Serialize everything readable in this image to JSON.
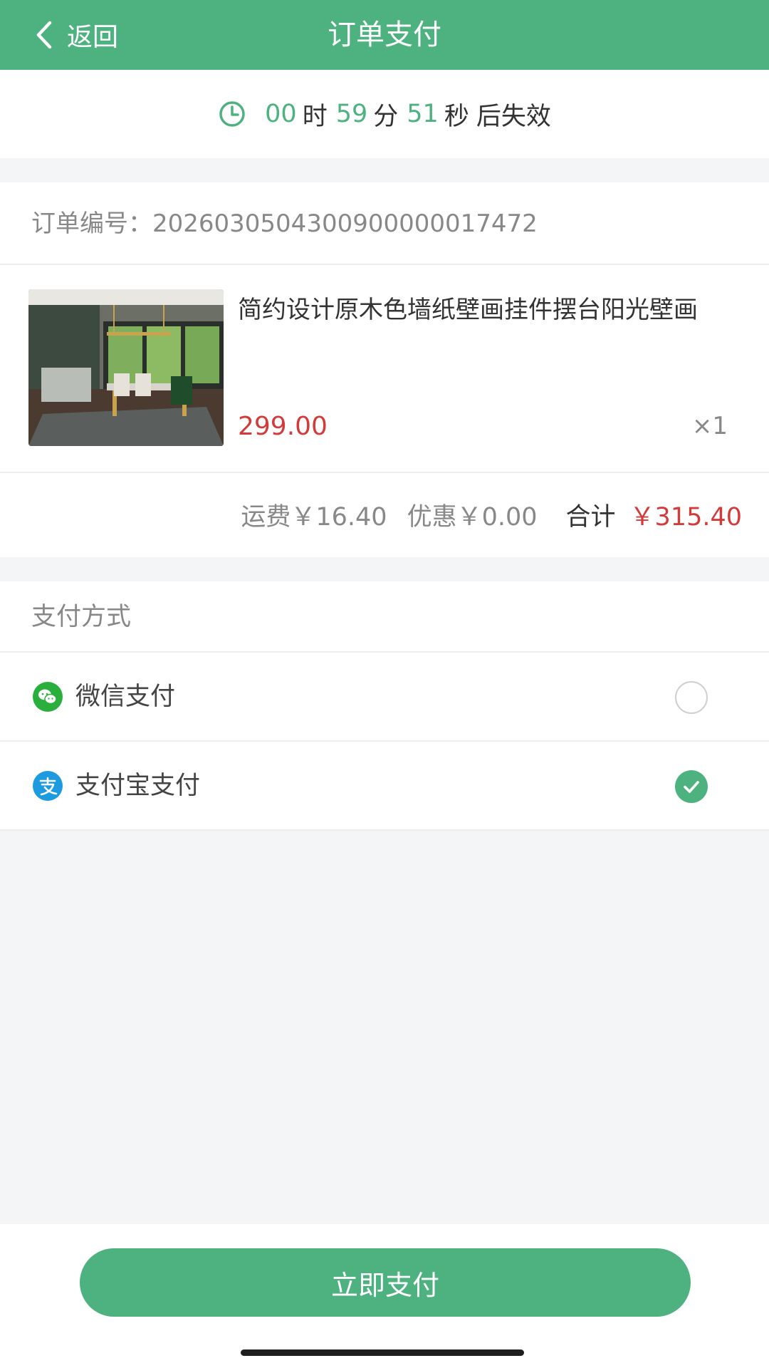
{
  "header": {
    "back_label": "返回",
    "title": "订单支付"
  },
  "countdown": {
    "hours": "00",
    "hours_unit": "时",
    "minutes": "59",
    "minutes_unit": "分",
    "seconds": "51",
    "seconds_unit": "秒",
    "suffix": "后失效"
  },
  "order": {
    "order_no_text": "订单编号：2026030504300900000017472",
    "product": {
      "name": "简约设计原木色墙纸壁画挂件摆台阳光壁画",
      "price": "299.00",
      "quantity": "×1"
    },
    "summary": {
      "shipping": "运费￥16.40",
      "discount": "优惠￥0.00",
      "total_label": "合计",
      "total": "￥315.40"
    }
  },
  "payment": {
    "title": "支付方式",
    "methods": [
      {
        "label": "微信支付",
        "icon": "wechat-pay-icon",
        "selected": false
      },
      {
        "label": "支付宝支付",
        "icon": "alipay-icon",
        "selected": true
      }
    ]
  },
  "actions": {
    "pay_now_label": "立即支付"
  },
  "colors": {
    "primary": "#4db27f",
    "price": "#d33b3b"
  }
}
